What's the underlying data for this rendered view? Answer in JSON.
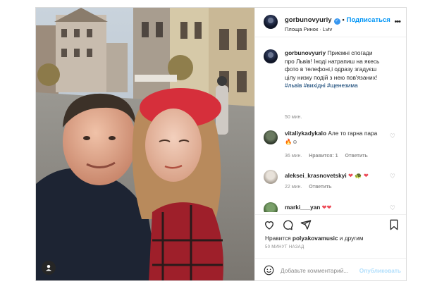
{
  "post": {
    "username": "gorbunovyuriy",
    "follow_label": "Подписаться",
    "location": "Площа Ринок · Lviv",
    "caption_user": "gorbunovyuriy",
    "caption_text": "Приємні спогади про Львів! Іноді натрапиш на якесь фото в телефоні,і одразу згадуєш цілу низку подій з нею пов'язаних!",
    "hashtags": "#львів #вихідні #щенезима",
    "caption_time": "50 мин."
  },
  "comments": [
    {
      "user": "vitaliykadykalo",
      "text": "Але то гарна пара",
      "emoji": "🔥☺",
      "time": "36 мин.",
      "likes": "Нравится: 1",
      "reply": "Ответить"
    },
    {
      "user": "aleksei_krasnovetskyi",
      "text": "",
      "emoji": "❤ 🐢 ❤",
      "time": "22 мин.",
      "likes": "",
      "reply": "Ответить"
    },
    {
      "user": "marki___yan",
      "text": "",
      "emoji": "❤❤",
      "time": "",
      "likes": "",
      "reply": ""
    }
  ],
  "likes_text_prefix": "Нравится ",
  "likes_user": "polyakovamusic",
  "likes_text_suffix": " и другим",
  "post_time": "50 МИНУТ НАЗАД",
  "comment_input": {
    "placeholder": "Добавьте комментарий...",
    "publish_label": "Опубликовать"
  },
  "colors": {
    "accent": "#0095f6",
    "verified": "#3897f0",
    "hashtag": "#00376b",
    "like_red": "#ed4956",
    "publish_disabled": "#b2dffc"
  },
  "icons": [
    "heart-icon",
    "comment-icon",
    "share-icon",
    "bookmark-icon",
    "emoji-icon",
    "more-icon",
    "user-tag-icon"
  ]
}
